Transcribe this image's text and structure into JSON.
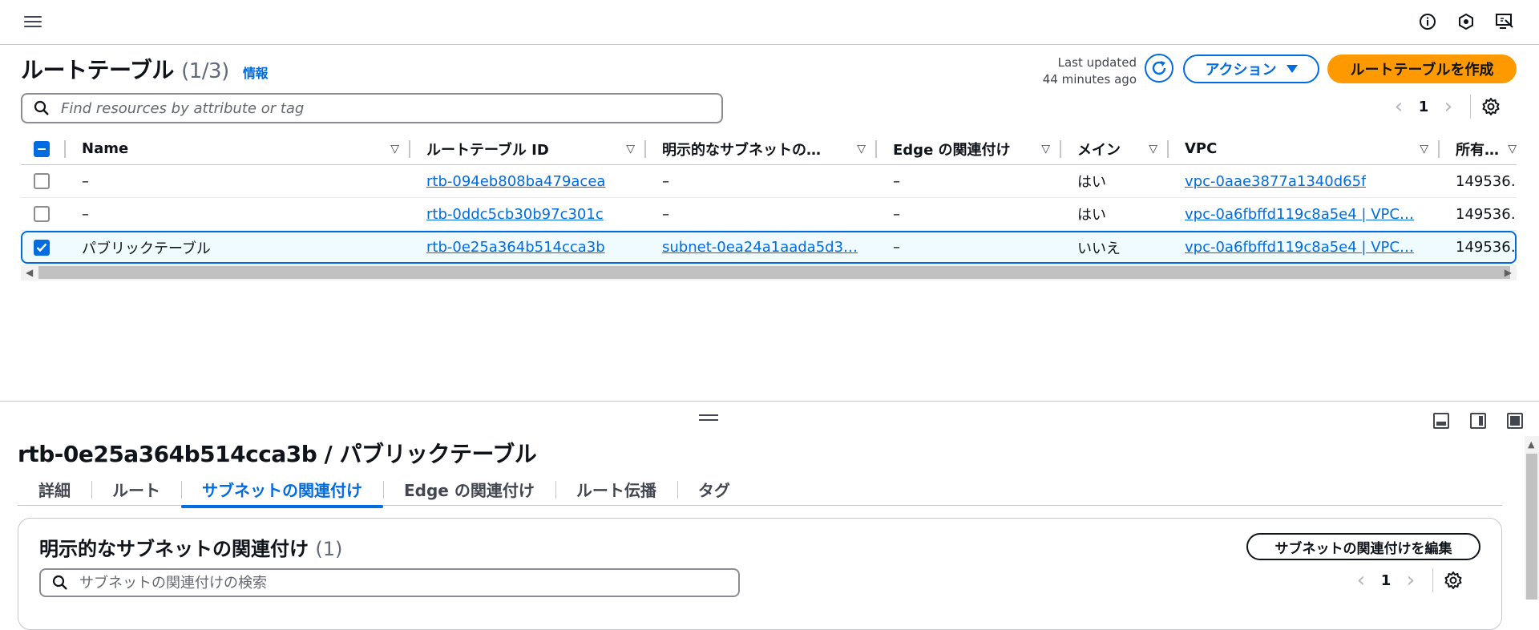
{
  "topbar": {
    "icons": [
      "menu-icon",
      "info-icon",
      "notifications-icon",
      "feedback-icon"
    ]
  },
  "header": {
    "title": "ルートテーブル",
    "count": "(1/3)",
    "info": "情報",
    "last_updated_label": "Last updated",
    "last_updated_value": "44 minutes ago",
    "actions_label": "アクション",
    "create_label": "ルートテーブルを作成"
  },
  "search": {
    "placeholder": "Find resources by attribute or tag"
  },
  "pagination": {
    "page": "1"
  },
  "table": {
    "columns": [
      "Name",
      "ルートテーブル ID",
      "明示的なサブネットの…",
      "Edge の関連付け",
      "メイン",
      "VPC",
      "所有…"
    ],
    "rows": [
      {
        "selected": false,
        "name": "–",
        "route_table_id": "rtb-094eb808ba479acea",
        "subnet": "–",
        "edge": "–",
        "main": "はい",
        "vpc": "vpc-0aae3877a1340d65f",
        "owner": "149536…"
      },
      {
        "selected": false,
        "name": "–",
        "route_table_id": "rtb-0ddc5cb30b97c301c",
        "subnet": "–",
        "edge": "–",
        "main": "はい",
        "vpc": "vpc-0a6fbffd119c8a5e4 | VPC…",
        "owner": "149536…"
      },
      {
        "selected": true,
        "name": "パブリックテーブル",
        "route_table_id": "rtb-0e25a364b514cca3b",
        "subnet": "subnet-0ea24a1aada5d3…",
        "edge": "–",
        "main": "いいえ",
        "vpc": "vpc-0a6fbffd119c8a5e4 | VPC…",
        "owner": "149536…"
      }
    ]
  },
  "detail": {
    "title": "rtb-0e25a364b514cca3b / パブリックテーブル",
    "tabs": [
      {
        "label": "詳細",
        "active": false
      },
      {
        "label": "ルート",
        "active": false
      },
      {
        "label": "サブネットの関連付け",
        "active": true
      },
      {
        "label": "Edge の関連付け",
        "active": false
      },
      {
        "label": "ルート伝播",
        "active": false
      },
      {
        "label": "タグ",
        "active": false
      }
    ],
    "section_title": "明示的なサブネットの関連付け",
    "section_count": "(1)",
    "edit_label": "サブネットの関連付けを編集",
    "search_placeholder": "サブネットの関連付けの検索",
    "page": "1"
  },
  "colors": {
    "primary": "#006ce0",
    "accent_orange": "#ff9900",
    "selected_row_bg": "#f0fbff",
    "text": "#0f141a"
  }
}
